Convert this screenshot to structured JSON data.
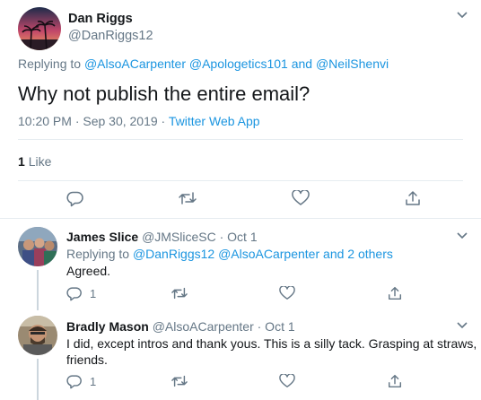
{
  "main_tweet": {
    "author_name": "Dan Riggs",
    "handle": "@DanRiggs12",
    "replying_prefix": "Replying to",
    "reply_to_1": "@AlsoACarpenter",
    "reply_to_2": "@Apologetics101",
    "reply_and": "and",
    "reply_to_3": "@NeilShenvi",
    "text": "Why not publish the entire email?",
    "timestamp": "10:20 PM · Sep 30, 2019 ·",
    "source": "Twitter Web App",
    "likes_count": "1",
    "likes_label": "Like"
  },
  "replies": [
    {
      "author_name": "James Slice",
      "meta": "@JMSliceSC · Oct 1",
      "replying_prefix": "Replying to",
      "reply_to_1": "@DanRiggs12",
      "reply_to_2": "@AlsoACarpenter",
      "reply_others": "and 2 others",
      "text": "Agreed.",
      "reply_count": "1"
    },
    {
      "author_name": "Bradly Mason",
      "meta": "@AlsoACarpenter · Oct 1",
      "text_line1": "I did, except intros and thank yous. This is a silly tack. Grasping at straws,",
      "text_line2": "friends.",
      "reply_count": "1"
    }
  ],
  "icons": [
    "chevron-down-icon",
    "reply-icon",
    "retweet-icon",
    "like-icon",
    "share-icon"
  ],
  "colors": {
    "link": "#1b95e0",
    "muted": "#657786",
    "divider": "#e6ecf0"
  }
}
